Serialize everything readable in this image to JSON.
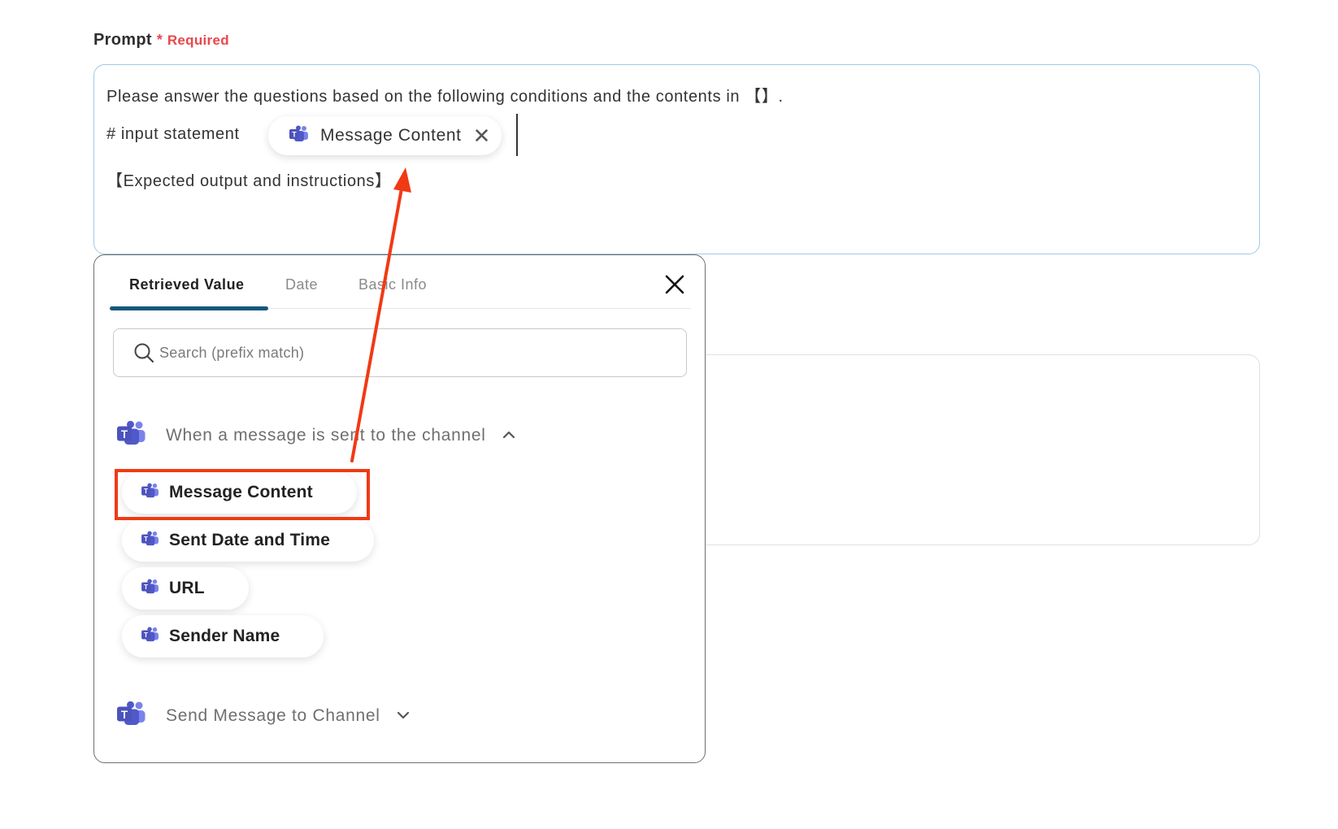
{
  "field": {
    "label": "Prompt",
    "required_star": "*",
    "required_text": "Required"
  },
  "prompt": {
    "line1": "Please answer the questions based on the following conditions and the contents in 【】.",
    "line2_prefix": "# input statement",
    "chip": {
      "label": "Message Content",
      "icon": "teams-icon",
      "remove_icon": "close-icon"
    },
    "line3": "【Expected output and instructions】"
  },
  "picker": {
    "tabs": [
      {
        "label": "Retrieved Value",
        "active": true
      },
      {
        "label": "Date",
        "active": false
      },
      {
        "label": "Basic Info",
        "active": false
      }
    ],
    "close_icon": "close-icon",
    "search": {
      "placeholder": "Search (prefix match)",
      "value": ""
    },
    "groups": [
      {
        "title": "When a message is sent to the channel",
        "expanded": true,
        "icon": "teams-icon",
        "items": [
          {
            "label": "Message Content",
            "highlighted": true
          },
          {
            "label": "Sent Date and Time"
          },
          {
            "label": "URL"
          },
          {
            "label": "Sender Name"
          }
        ]
      },
      {
        "title": "Send Message to Channel",
        "expanded": false,
        "icon": "teams-icon",
        "items": []
      }
    ]
  },
  "colors": {
    "accent": "#13587d",
    "required": "#e8484a",
    "annotation": "#f03a14",
    "teams_purple": "#5059c9",
    "input_border_focus": "#9ccbe8"
  }
}
